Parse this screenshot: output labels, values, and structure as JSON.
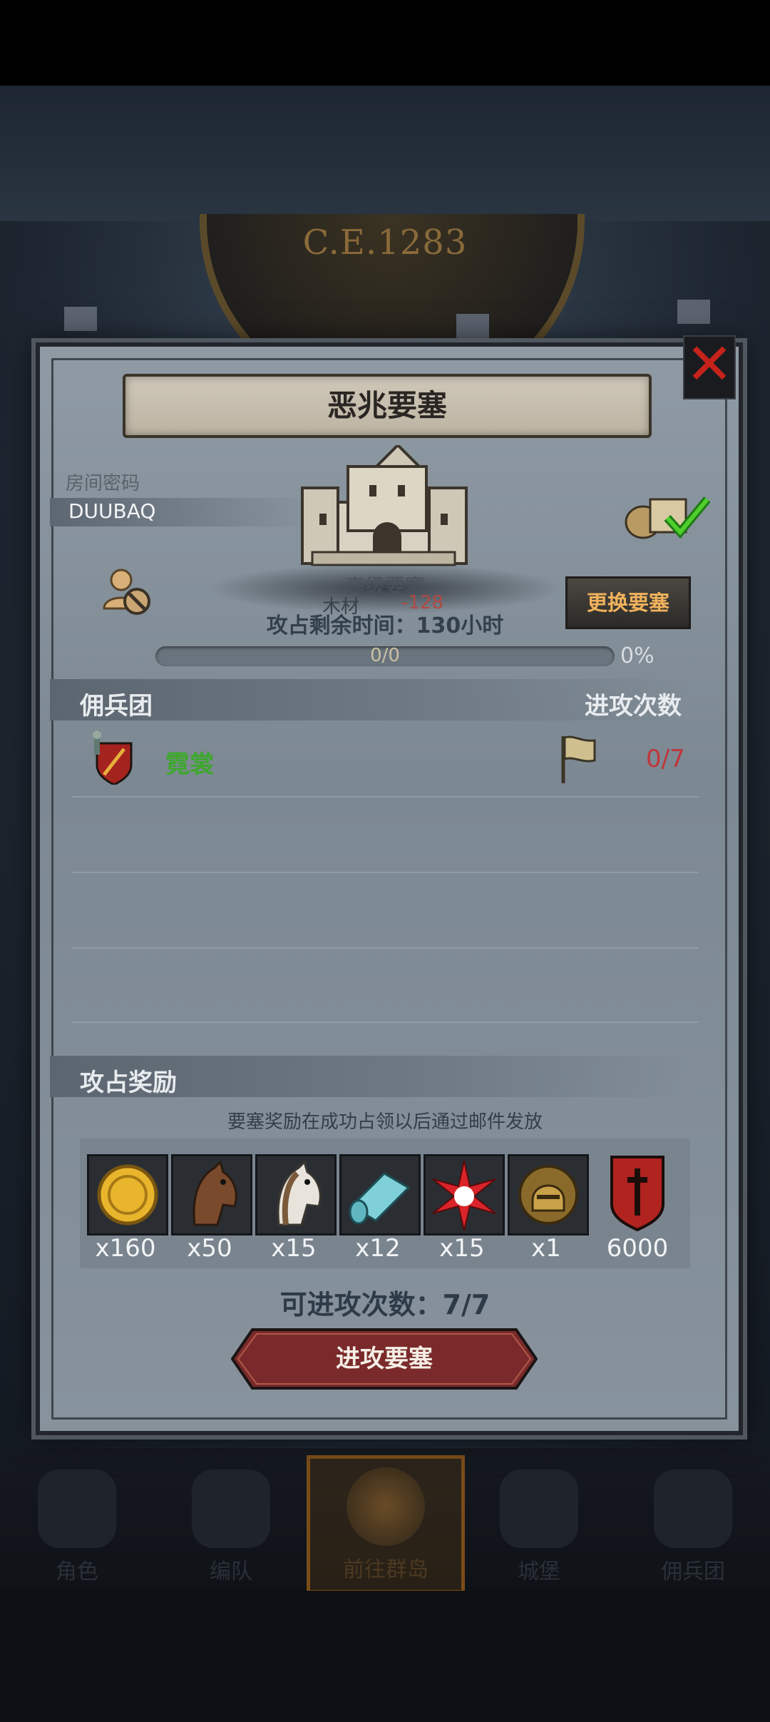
{
  "map": {
    "year": "C.E.1283"
  },
  "dialog": {
    "title": "恶兆要塞",
    "close_icon": "close-x-icon",
    "room_password_label": "房间密码",
    "room_password": "DUUBAQ",
    "fort_level": "高级要塞",
    "wood_label": "木材",
    "wood_value": "-128",
    "swap_button": "更换要塞",
    "time_left": "攻占剩余时间：130小时",
    "progress": {
      "count": "0/0",
      "percent": "0%",
      "fraction": 0
    },
    "mercenary_header": "佣兵团",
    "attack_count_header": "进攻次数",
    "mercenaries": [
      {
        "name": "霓裳",
        "attacks": "0/7"
      }
    ],
    "rewards_header": "攻占奖励",
    "rewards_note": "要塞奖励在成功占领以后通过邮件发放",
    "rewards": [
      {
        "icon": "gold-coin-icon",
        "qty": "x160"
      },
      {
        "icon": "brown-horse-icon",
        "qty": "x50"
      },
      {
        "icon": "white-horse-icon",
        "qty": "x15"
      },
      {
        "icon": "cloth-roll-icon",
        "qty": "x12"
      },
      {
        "icon": "red-star-icon",
        "qty": "x15"
      },
      {
        "icon": "knight-helmet-icon",
        "qty": "x1"
      },
      {
        "icon": "guild-banner-icon",
        "qty": "6000"
      }
    ],
    "attacks_available": "可进攻次数：7/7",
    "attack_button": "进攻要塞"
  },
  "nav": [
    {
      "label": "角色",
      "icon": "knight-icon"
    },
    {
      "label": "编队",
      "icon": "helmet-icon"
    },
    {
      "label": "前往群岛",
      "icon": "compass-icon",
      "active": true
    },
    {
      "label": "城堡",
      "icon": "castle-icon"
    },
    {
      "label": "佣兵团",
      "icon": "ship-icon"
    }
  ],
  "colors": {
    "accent_gold": "#f0b25c",
    "danger_red": "#c0353a",
    "merc_green": "#3da82d"
  }
}
